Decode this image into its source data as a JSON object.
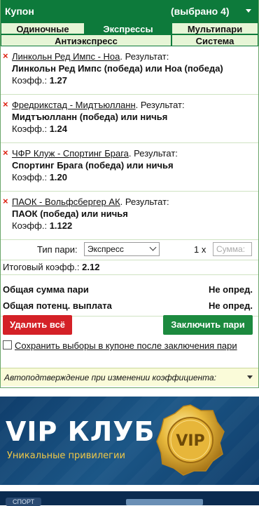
{
  "header": {
    "title": "Купон",
    "selected": "(выбрано 4)"
  },
  "tabs": [
    "Одиночные",
    "Экспрессы",
    "Мультипари"
  ],
  "tabs2": [
    "Антиэкспресс",
    "Система"
  ],
  "bets": [
    {
      "event": "Линкольн Ред Импс - Ноа",
      "result_label": ". Результат:",
      "pick": "Линкольн Ред Импс (победа) или Ноа (победа)",
      "coef_label": "Коэфф.:",
      "coef": "1.27"
    },
    {
      "event": "Фредрикстад - Мидтъюлланн",
      "result_label": ". Результат:",
      "pick": "Мидтъюлланн (победа) или ничья",
      "coef_label": "Коэфф.:",
      "coef": "1.24"
    },
    {
      "event": "ЧФР Клуж - Спортинг Брага",
      "result_label": ". Результат:",
      "pick": "Спортинг Брага (победа) или ничья",
      "coef_label": "Коэфф.:",
      "coef": "1.20"
    },
    {
      "event": "ПАОК - Вольфсбергер АК",
      "result_label": ". Результат:",
      "pick": "ПАОК (победа) или ничья",
      "coef_label": "Коэфф.:",
      "coef": "1.122"
    }
  ],
  "bet_type": {
    "label": "Тип пари:",
    "value": "Экспресс",
    "multiplier": "1 x",
    "amount_placeholder": "Сумма:"
  },
  "total": {
    "label": "Итоговый коэфф.:",
    "value": "2.12"
  },
  "sums": [
    {
      "label": "Общая сумма пари",
      "value": "Не опред."
    },
    {
      "label": "Общая потенц. выплата",
      "value": "Не опред."
    }
  ],
  "buttons": {
    "delete": "Удалить всё",
    "confirm": "Заключить пари"
  },
  "save_choice": "Сохранить выборы в купоне после заключения пари",
  "auto_confirm": "Автоподтверждение при изменении коэффициента:",
  "banner": {
    "title": "VIP КЛУБ",
    "subtitle": "Уникальные привилегии",
    "badge": "VIP"
  },
  "bottom_tag": "СПОРТ",
  "colors": {
    "brand_green": "#0d7a3b",
    "tab_bg": "#e6f5d6",
    "delete_red": "#d42127",
    "confirm_green": "#1c8a3f"
  }
}
